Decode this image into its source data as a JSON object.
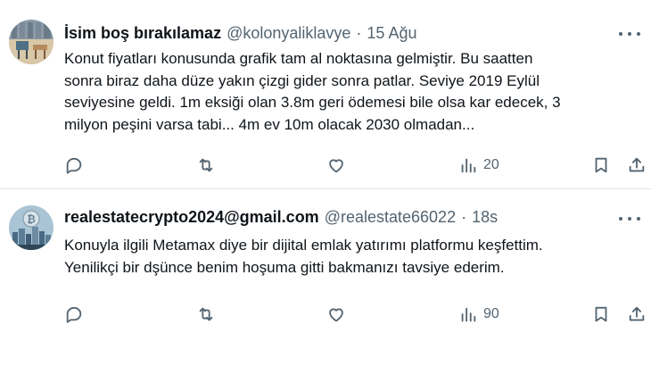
{
  "posts": [
    {
      "display_name": "İsim boş bırakılamaz",
      "handle": "@kolonyaliklavye",
      "separator": "·",
      "time": "15 Ağu",
      "text_lines": [
        "Konut fiyatları konusunda grafik tam al noktasına gelmiştir. Bu saatten",
        "sonra biraz daha düze yakın çizgi gider sonra patlar. Seviye 2019 Eylül",
        "seviyesine geldi. 1m eksiği olan 3.8m geri ödemesi bile olsa kar edecek, 3",
        "milyon peşini varsa tabi... 4m ev 10m olacak 2030 olmadan..."
      ],
      "views": "20",
      "avatar_icon": "patio-chairs-photo"
    },
    {
      "display_name": "realestatecrypto2024@gmail.com",
      "handle": "@realestate66022",
      "separator": "·",
      "time": "18s",
      "text_lines": [
        "Konuyla ilgili Metamax diye bir dijital emlak yatırımı platformu keşfettim.",
        "Yenilikçi bir dşünce benim hoşuma gitti bakmanızı tavsiye ederim."
      ],
      "views": "90",
      "avatar_icon": "crypto-city-photo"
    }
  ],
  "icons": {
    "reply": "reply-icon",
    "repost": "repost-icon",
    "like": "like-icon",
    "views": "views-icon",
    "bookmark": "bookmark-icon",
    "share": "share-icon",
    "more": "more-icon"
  },
  "colors": {
    "text": "#0f1419",
    "secondary": "#536471",
    "divider": "#dfe4e8"
  }
}
